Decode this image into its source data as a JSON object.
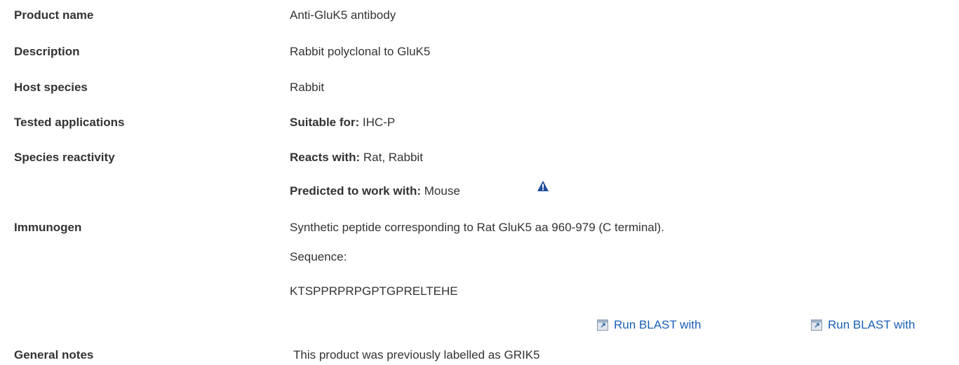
{
  "rows": {
    "product_name": {
      "label": "Product name",
      "value": "Anti-GluK5 antibody"
    },
    "description": {
      "label": "Description",
      "value": "Rabbit polyclonal to GluK5"
    },
    "host_species": {
      "label": "Host species",
      "value": "Rabbit"
    },
    "tested_applications": {
      "label": "Tested applications",
      "prefix": "Suitable for:",
      "value": "IHC-P"
    },
    "species_reactivity": {
      "label": "Species reactivity",
      "reacts_prefix": "Reacts with:",
      "reacts_value": "Rat, Rabbit",
      "predicted_prefix": "Predicted to work with:",
      "predicted_value": "Mouse"
    },
    "immunogen": {
      "label": "Immunogen",
      "value": "Synthetic peptide corresponding to Rat GluK5 aa 960-979 (C terminal).",
      "sequence_label": "Sequence:",
      "sequence": "KTSPPRPRPGPTGPRELTEHE"
    },
    "general_notes": {
      "label": "General notes",
      "value": "This product was previously labelled as GRIK5"
    }
  },
  "blast_links": [
    "Run BLAST with",
    "Run BLAST with"
  ],
  "icons": {
    "warning": "warning-triangle-icon",
    "blast": "external-window-icon"
  },
  "colors": {
    "link": "#1a5fb4",
    "warning": "#1f4e9c",
    "text": "#333333"
  }
}
